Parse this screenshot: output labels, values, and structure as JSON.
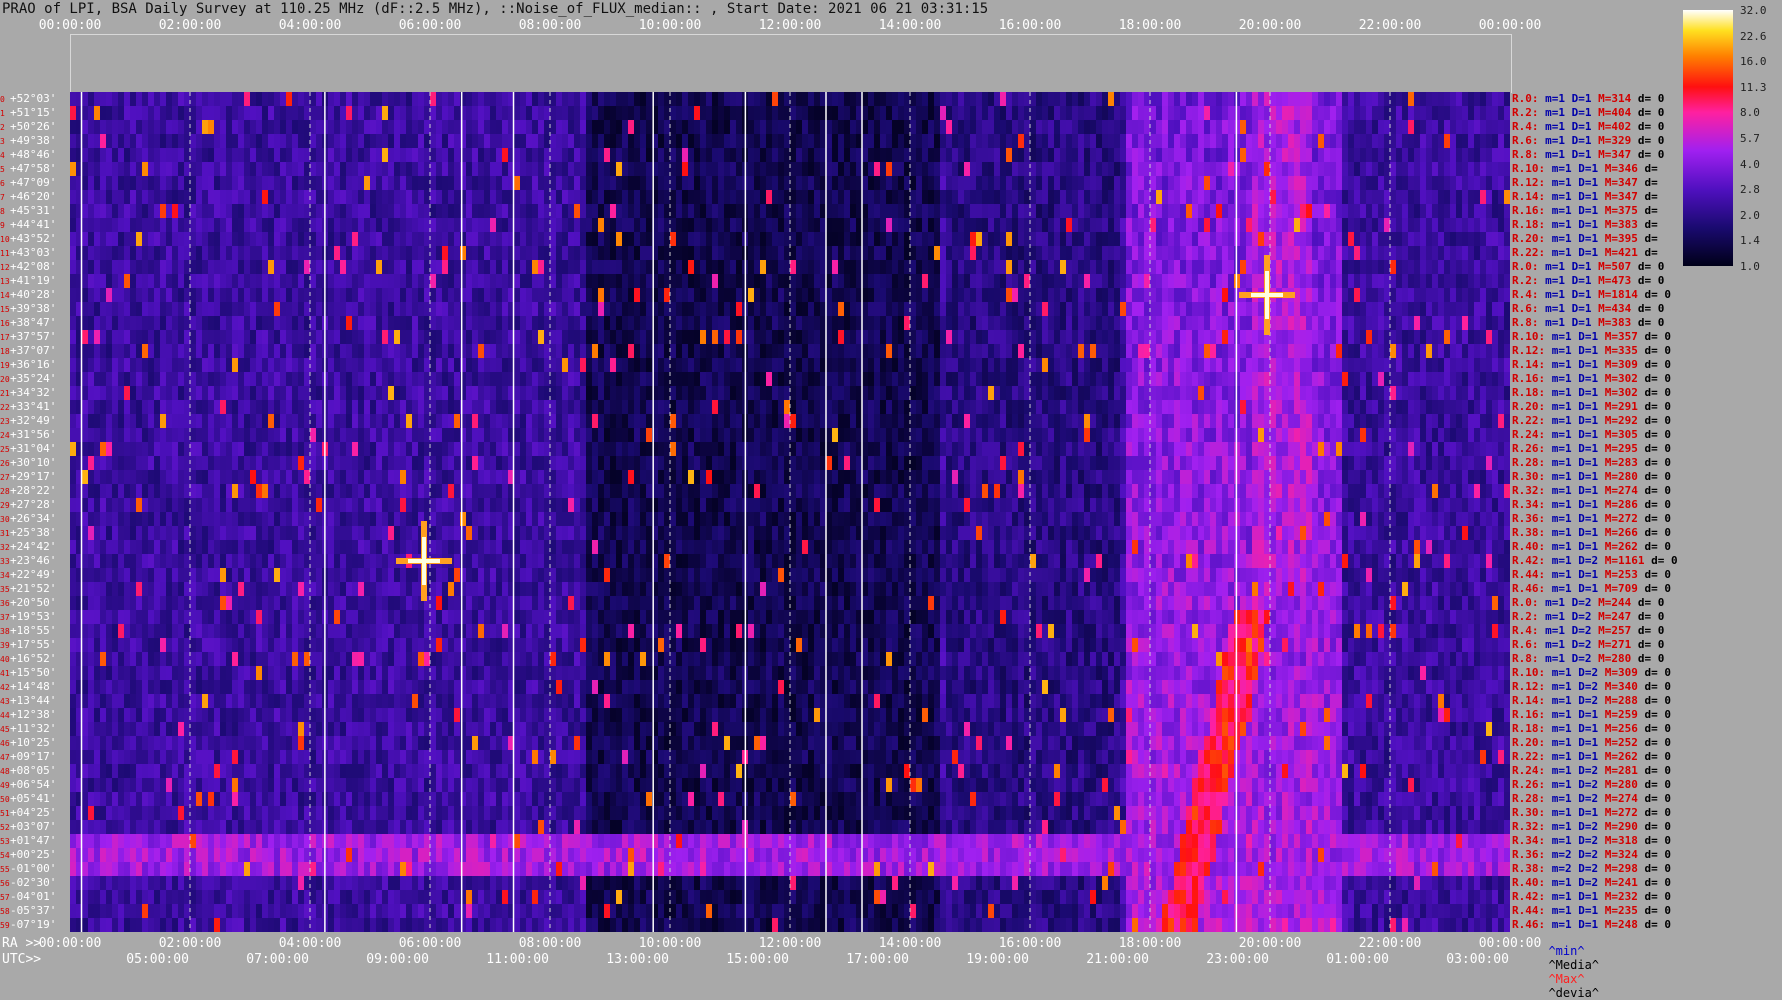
{
  "title": "PRAO of LPI, BSA Daily Survey at 110.25 MHz (dF::2.5 MHz), ::Noise_of_FLUX_median:: , Start Date: 2021 06 21 03:31:15",
  "top_ticks": [
    "00:00:00",
    "02:00:00",
    "04:00:00",
    "06:00:00",
    "08:00:00",
    "10:00:00",
    "12:00:00",
    "14:00:00",
    "16:00:00",
    "18:00:00",
    "20:00:00",
    "22:00:00",
    "00:00:00"
  ],
  "bottom_ra_prefix": "RA >>",
  "bottom_ra_ticks": [
    "00:00:00",
    "02:00:00",
    "04:00:00",
    "06:00:00",
    "08:00:00",
    "10:00:00",
    "12:00:00",
    "14:00:00",
    "16:00:00",
    "18:00:00",
    "20:00:00",
    "22:00:00",
    "00:00:00"
  ],
  "bottom_utc_prefix": "UTC>>",
  "bottom_utc_ticks": [
    "05:00:00",
    "07:00:00",
    "09:00:00",
    "11:00:00",
    "13:00:00",
    "15:00:00",
    "17:00:00",
    "19:00:00",
    "21:00:00",
    "23:00:00",
    "01:00:00",
    "03:00:00"
  ],
  "declinations": [
    {
      "i": "0",
      "d": "+52°03'"
    },
    {
      "i": "1",
      "d": "+51°15'"
    },
    {
      "i": "2",
      "d": "+50°26'"
    },
    {
      "i": "3",
      "d": "+49°38'"
    },
    {
      "i": "4",
      "d": "+48°46'"
    },
    {
      "i": "5",
      "d": "+47°58'"
    },
    {
      "i": "6",
      "d": "+47°09'"
    },
    {
      "i": "7",
      "d": "+46°20'"
    },
    {
      "i": "8",
      "d": "+45°31'"
    },
    {
      "i": "9",
      "d": "+44°41'"
    },
    {
      "i": "10",
      "d": "+43°52'"
    },
    {
      "i": "11",
      "d": "+43°03'"
    },
    {
      "i": "12",
      "d": "+42°08'"
    },
    {
      "i": "13",
      "d": "+41°19'"
    },
    {
      "i": "14",
      "d": "+40°28'"
    },
    {
      "i": "15",
      "d": "+39°38'"
    },
    {
      "i": "16",
      "d": "+38°47'"
    },
    {
      "i": "17",
      "d": "+37°57'"
    },
    {
      "i": "18",
      "d": "+37°07'"
    },
    {
      "i": "19",
      "d": "+36°16'"
    },
    {
      "i": "20",
      "d": "+35°24'"
    },
    {
      "i": "21",
      "d": "+34°32'"
    },
    {
      "i": "22",
      "d": "+33°41'"
    },
    {
      "i": "23",
      "d": "+32°49'"
    },
    {
      "i": "24",
      "d": "+31°56'"
    },
    {
      "i": "25",
      "d": "+31°04'"
    },
    {
      "i": "26",
      "d": "+30°10'"
    },
    {
      "i": "27",
      "d": "+29°17'"
    },
    {
      "i": "28",
      "d": "+28°22'"
    },
    {
      "i": "29",
      "d": "+27°28'"
    },
    {
      "i": "30",
      "d": "+26°34'"
    },
    {
      "i": "31",
      "d": "+25°38'"
    },
    {
      "i": "32",
      "d": "+24°42'"
    },
    {
      "i": "33",
      "d": "+23°46'"
    },
    {
      "i": "34",
      "d": "+22°49'"
    },
    {
      "i": "35",
      "d": "+21°52'"
    },
    {
      "i": "36",
      "d": "+20°50'"
    },
    {
      "i": "37",
      "d": "+19°53'"
    },
    {
      "i": "38",
      "d": "+18°55'"
    },
    {
      "i": "39",
      "d": "+17°55'"
    },
    {
      "i": "40",
      "d": "+16°52'"
    },
    {
      "i": "41",
      "d": "+15°50'"
    },
    {
      "i": "42",
      "d": "+14°48'"
    },
    {
      "i": "43",
      "d": "+13°44'"
    },
    {
      "i": "44",
      "d": "+12°38'"
    },
    {
      "i": "45",
      "d": "+11°32'"
    },
    {
      "i": "46",
      "d": "+10°25'"
    },
    {
      "i": "47",
      "d": "+09°17'"
    },
    {
      "i": "48",
      "d": "+08°05'"
    },
    {
      "i": "49",
      "d": "+06°54'"
    },
    {
      "i": "50",
      "d": "+05°41'"
    },
    {
      "i": "51",
      "d": "+04°25'"
    },
    {
      "i": "52",
      "d": "+03°07'"
    },
    {
      "i": "53",
      "d": "+01°47'"
    },
    {
      "i": "54",
      "d": "+00°25'"
    },
    {
      "i": "55",
      "d": "-01°00'"
    },
    {
      "i": "56",
      "d": "-02°30'"
    },
    {
      "i": "57",
      "d": "-04°01'"
    },
    {
      "i": "58",
      "d": "-05°37'"
    },
    {
      "i": "59",
      "d": "-07°19'"
    }
  ],
  "stats": [
    {
      "r": "R.0:",
      "m": "m=1 D=1",
      "max": "M=314",
      "d": "d= 0"
    },
    {
      "r": "R.2:",
      "m": "m=1 D=1",
      "max": "M=404",
      "d": "d= 0"
    },
    {
      "r": "R.4:",
      "m": "m=1 D=1",
      "max": "M=402",
      "d": "d= 0"
    },
    {
      "r": "R.6:",
      "m": "m=1 D=1",
      "max": "M=329",
      "d": "d= 0"
    },
    {
      "r": "R.8:",
      "m": "m=1 D=1",
      "max": "M=347",
      "d": "d= 0"
    },
    {
      "r": "R.10:",
      "m": "m=1 D=1",
      "max": "M=346",
      "d": "d="
    },
    {
      "r": "R.12:",
      "m": "m=1 D=1",
      "max": "M=347",
      "d": "d="
    },
    {
      "r": "R.14:",
      "m": "m=1 D=1",
      "max": "M=347",
      "d": "d="
    },
    {
      "r": "R.16:",
      "m": "m=1 D=1",
      "max": "M=375",
      "d": "d="
    },
    {
      "r": "R.18:",
      "m": "m=1 D=1",
      "max": "M=383",
      "d": "d="
    },
    {
      "r": "R.20:",
      "m": "m=1 D=1",
      "max": "M=395",
      "d": "d="
    },
    {
      "r": "R.22:",
      "m": "m=1 D=1",
      "max": "M=421",
      "d": "d="
    },
    {
      "r": "R.0:",
      "m": "m=1 D=1",
      "max": "M=507",
      "d": "d= 0"
    },
    {
      "r": "R.2:",
      "m": "m=1 D=1",
      "max": "M=473",
      "d": "d= 0"
    },
    {
      "r": "R.4:",
      "m": "m=1 D=1",
      "max": "M=1814",
      "d": "d= 0"
    },
    {
      "r": "R.6:",
      "m": "m=1 D=1",
      "max": "M=434",
      "d": "d= 0"
    },
    {
      "r": "R.8:",
      "m": "m=1 D=1",
      "max": "M=383",
      "d": "d= 0"
    },
    {
      "r": "R.10:",
      "m": "m=1 D=1",
      "max": "M=357",
      "d": "d= 0"
    },
    {
      "r": "R.12:",
      "m": "m=1 D=1",
      "max": "M=335",
      "d": "d= 0"
    },
    {
      "r": "R.14:",
      "m": "m=1 D=1",
      "max": "M=309",
      "d": "d= 0"
    },
    {
      "r": "R.16:",
      "m": "m=1 D=1",
      "max": "M=302",
      "d": "d= 0"
    },
    {
      "r": "R.18:",
      "m": "m=1 D=1",
      "max": "M=302",
      "d": "d= 0"
    },
    {
      "r": "R.20:",
      "m": "m=1 D=1",
      "max": "M=291",
      "d": "d= 0"
    },
    {
      "r": "R.22:",
      "m": "m=1 D=1",
      "max": "M=292",
      "d": "d= 0"
    },
    {
      "r": "R.24:",
      "m": "m=1 D=1",
      "max": "M=305",
      "d": "d= 0"
    },
    {
      "r": "R.26:",
      "m": "m=1 D=1",
      "max": "M=295",
      "d": "d= 0"
    },
    {
      "r": "R.28:",
      "m": "m=1 D=1",
      "max": "M=283",
      "d": "d= 0"
    },
    {
      "r": "R.30:",
      "m": "m=1 D=1",
      "max": "M=280",
      "d": "d= 0"
    },
    {
      "r": "R.32:",
      "m": "m=1 D=1",
      "max": "M=274",
      "d": "d= 0"
    },
    {
      "r": "R.34:",
      "m": "m=1 D=1",
      "max": "M=286",
      "d": "d= 0"
    },
    {
      "r": "R.36:",
      "m": "m=1 D=1",
      "max": "M=272",
      "d": "d= 0"
    },
    {
      "r": "R.38:",
      "m": "m=1 D=1",
      "max": "M=266",
      "d": "d= 0"
    },
    {
      "r": "R.40:",
      "m": "m=1 D=1",
      "max": "M=262",
      "d": "d= 0"
    },
    {
      "r": "R.42:",
      "m": "m=1 D=2",
      "max": "M=1161",
      "d": "d= 0"
    },
    {
      "r": "R.44:",
      "m": "m=1 D=1",
      "max": "M=253",
      "d": "d= 0"
    },
    {
      "r": "R.46:",
      "m": "m=1 D=1",
      "max": "M=709",
      "d": "d= 0"
    },
    {
      "r": "R.0:",
      "m": "m=1 D=2",
      "max": "M=244",
      "d": "d= 0"
    },
    {
      "r": "R.2:",
      "m": "m=1 D=2",
      "max": "M=247",
      "d": "d= 0"
    },
    {
      "r": "R.4:",
      "m": "m=1 D=2",
      "max": "M=257",
      "d": "d= 0"
    },
    {
      "r": "R.6:",
      "m": "m=1 D=2",
      "max": "M=271",
      "d": "d= 0"
    },
    {
      "r": "R.8:",
      "m": "m=1 D=2",
      "max": "M=280",
      "d": "d= 0"
    },
    {
      "r": "R.10:",
      "m": "m=1 D=2",
      "max": "M=309",
      "d": "d= 0"
    },
    {
      "r": "R.12:",
      "m": "m=1 D=2",
      "max": "M=340",
      "d": "d= 0"
    },
    {
      "r": "R.14:",
      "m": "m=1 D=2",
      "max": "M=288",
      "d": "d= 0"
    },
    {
      "r": "R.16:",
      "m": "m=1 D=1",
      "max": "M=259",
      "d": "d= 0"
    },
    {
      "r": "R.18:",
      "m": "m=1 D=1",
      "max": "M=256",
      "d": "d= 0"
    },
    {
      "r": "R.20:",
      "m": "m=1 D=1",
      "max": "M=252",
      "d": "d= 0"
    },
    {
      "r": "R.22:",
      "m": "m=1 D=1",
      "max": "M=262",
      "d": "d= 0"
    },
    {
      "r": "R.24:",
      "m": "m=1 D=2",
      "max": "M=281",
      "d": "d= 0"
    },
    {
      "r": "R.26:",
      "m": "m=1 D=2",
      "max": "M=280",
      "d": "d= 0"
    },
    {
      "r": "R.28:",
      "m": "m=1 D=2",
      "max": "M=274",
      "d": "d= 0"
    },
    {
      "r": "R.30:",
      "m": "m=1 D=1",
      "max": "M=272",
      "d": "d= 0"
    },
    {
      "r": "R.32:",
      "m": "m=1 D=2",
      "max": "M=290",
      "d": "d= 0"
    },
    {
      "r": "R.34:",
      "m": "m=1 D=2",
      "max": "M=318",
      "d": "d= 0"
    },
    {
      "r": "R.36:",
      "m": "m=2 D=2",
      "max": "M=324",
      "d": "d= 0"
    },
    {
      "r": "R.38:",
      "m": "m=2 D=2",
      "max": "M=298",
      "d": "d= 0"
    },
    {
      "r": "R.40:",
      "m": "m=1 D=2",
      "max": "M=241",
      "d": "d= 0"
    },
    {
      "r": "R.42:",
      "m": "m=1 D=1",
      "max": "M=232",
      "d": "d= 0"
    },
    {
      "r": "R.44:",
      "m": "m=1 D=1",
      "max": "M=235",
      "d": "d= 0"
    },
    {
      "r": "R.46:",
      "m": "m=1 D=1",
      "max": "M=248",
      "d": "d= 0"
    }
  ],
  "colorbar_ticks": [
    "32.0",
    "22.6",
    "16.0",
    "11.3",
    "8.0",
    "5.7",
    "4.0",
    "2.8",
    "2.0",
    "1.4",
    "1.0"
  ],
  "legend": {
    "min": "^min^",
    "median": "^Media^",
    "max": "^Max^",
    "devia": "^devia^"
  },
  "colors": {
    "background": "#a9a9a9",
    "low": "#000018",
    "mid": "#7a10d8",
    "high": "#ff1010",
    "peak": "#ffffd0"
  },
  "chart_data": {
    "type": "heatmap",
    "x_axis": "RA 00:00:00 to 00:00:00 (24h)",
    "y_axis": "declination rows, +52°03' to -07°19'",
    "colorscale": "log, 1.0 to 32.0",
    "features": [
      {
        "label": "bright source",
        "ra_hours": 5.9,
        "row": 33,
        "level": 32.0
      },
      {
        "label": "bright source",
        "ra_hours": 19.95,
        "row": 14,
        "level": 32.0
      },
      {
        "label": "galactic plane emission band",
        "ra_hours_start": 18.5,
        "ra_hours_end": 20.5,
        "level": 8.0
      },
      {
        "label": "horizontal band",
        "row_start": 53,
        "row_end": 55,
        "level": 4.0
      }
    ]
  }
}
